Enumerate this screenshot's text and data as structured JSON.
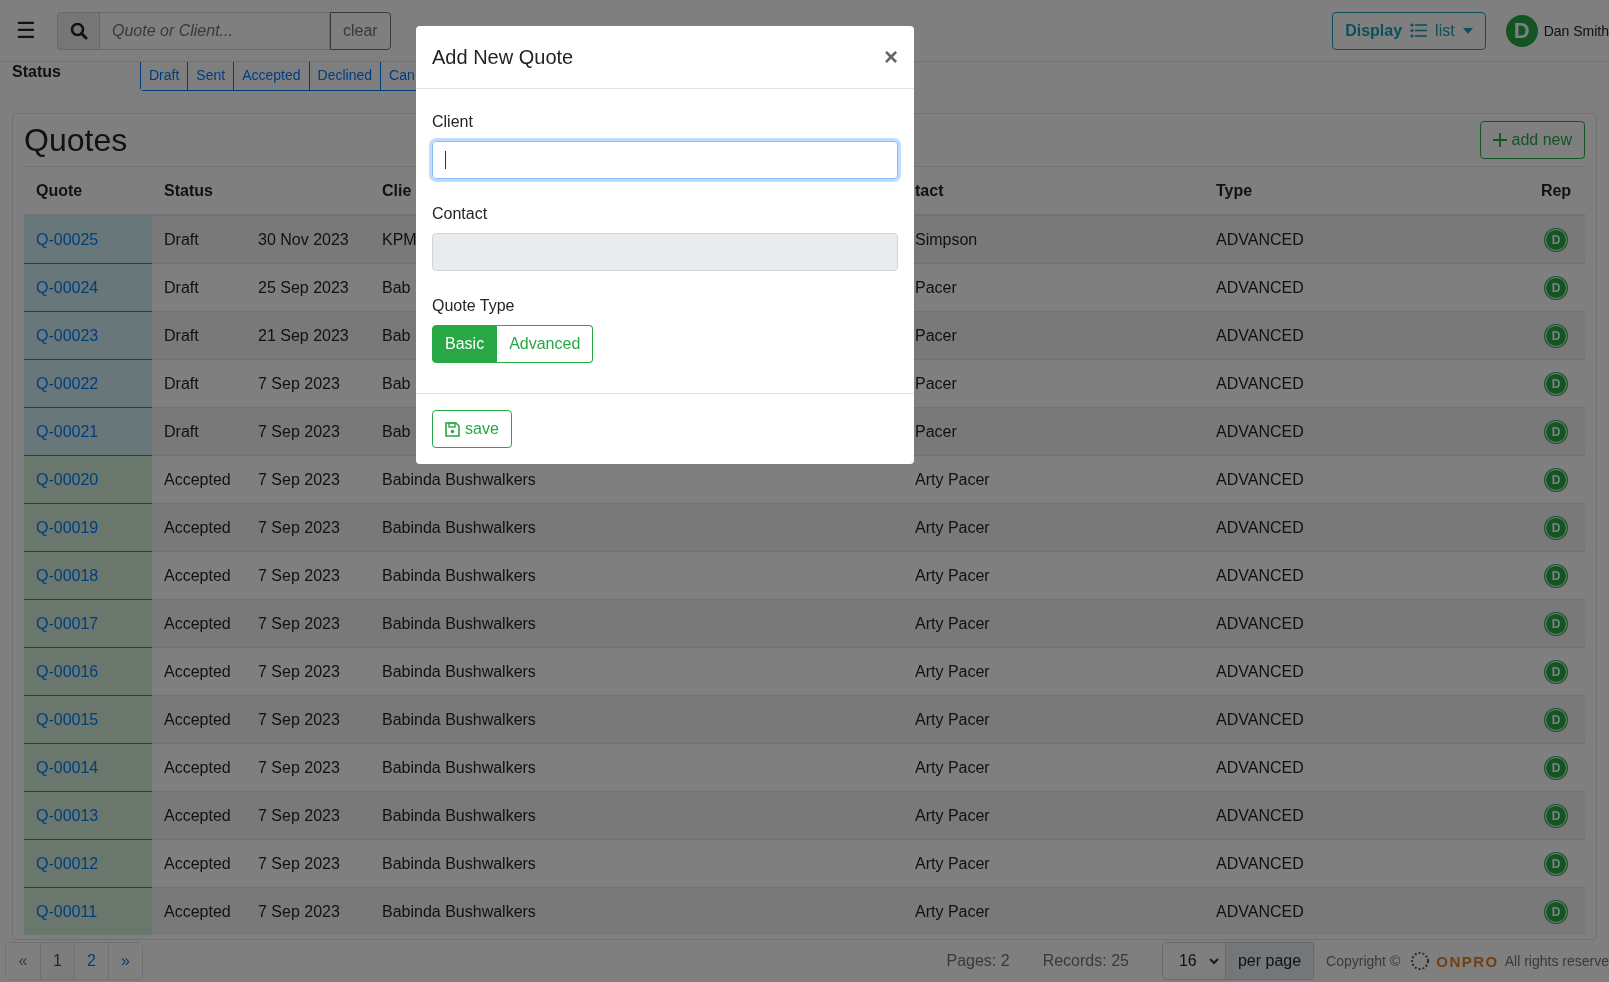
{
  "header": {
    "menu_glyph": "☰",
    "search": {
      "placeholder": "Quote or Client..."
    },
    "clear": "clear",
    "display": {
      "label": "Display",
      "value": "list"
    },
    "user": {
      "initial": "D",
      "name": "Dan Smith"
    }
  },
  "status_filter": {
    "label": "Status",
    "tabs": [
      {
        "label": "Draft",
        "selected": false
      },
      {
        "label": "Sent",
        "selected": false
      },
      {
        "label": "Accepted",
        "selected": false
      },
      {
        "label": "Declined",
        "selected": false
      },
      {
        "label": "Can",
        "selected": false
      }
    ]
  },
  "card": {
    "title": "Quotes",
    "add_button": "add new"
  },
  "table": {
    "columns": [
      "Quote",
      "Status",
      "",
      "Clie",
      "tact",
      "Type",
      "Rep"
    ],
    "rows": [
      {
        "quote": "Q-00025",
        "color": "#687779",
        "status": "Draft",
        "date": "30 Nov 2023",
        "client": "KPM",
        "contact": "Simpson",
        "type": "ADVANCED",
        "rep": "D"
      },
      {
        "quote": "Q-00024",
        "color": "#687779",
        "status": "Draft",
        "date": "25 Sep 2023",
        "client": "Bab",
        "contact": "Pacer",
        "type": "ADVANCED",
        "rep": "D"
      },
      {
        "quote": "Q-00023",
        "color": "#687779",
        "status": "Draft",
        "date": "21 Sep 2023",
        "client": "Bab",
        "contact": "Pacer",
        "type": "ADVANCED",
        "rep": "D"
      },
      {
        "quote": "Q-00022",
        "color": "#687779",
        "status": "Draft",
        "date": "7 Sep 2023",
        "client": "Bab",
        "contact": "Pacer",
        "type": "ADVANCED",
        "rep": "D"
      },
      {
        "quote": "Q-00021",
        "color": "#687779",
        "status": "Draft",
        "date": "7 Sep 2023",
        "client": "Bab",
        "contact": "Pacer",
        "type": "ADVANCED",
        "rep": "D"
      },
      {
        "quote": "Q-00020",
        "color": "#6a776d",
        "status": "Accepted",
        "date": "7 Sep 2023",
        "client": "Babinda Bushwalkers",
        "contact": "Arty Pacer",
        "type": "ADVANCED",
        "rep": "D"
      },
      {
        "quote": "Q-00019",
        "color": "#6a776d",
        "status": "Accepted",
        "date": "7 Sep 2023",
        "client": "Babinda Bushwalkers",
        "contact": "Arty Pacer",
        "type": "ADVANCED",
        "rep": "D"
      },
      {
        "quote": "Q-00018",
        "color": "#6a776d",
        "status": "Accepted",
        "date": "7 Sep 2023",
        "client": "Babinda Bushwalkers",
        "contact": "Arty Pacer",
        "type": "ADVANCED",
        "rep": "D"
      },
      {
        "quote": "Q-00017",
        "color": "#6a776d",
        "status": "Accepted",
        "date": "7 Sep 2023",
        "client": "Babinda Bushwalkers",
        "contact": "Arty Pacer",
        "type": "ADVANCED",
        "rep": "D"
      },
      {
        "quote": "Q-00016",
        "color": "#6a776d",
        "status": "Accepted",
        "date": "7 Sep 2023",
        "client": "Babinda Bushwalkers",
        "contact": "Arty Pacer",
        "type": "ADVANCED",
        "rep": "D"
      },
      {
        "quote": "Q-00015",
        "color": "#6a776d",
        "status": "Accepted",
        "date": "7 Sep 2023",
        "client": "Babinda Bushwalkers",
        "contact": "Arty Pacer",
        "type": "ADVANCED",
        "rep": "D"
      },
      {
        "quote": "Q-00014",
        "color": "#6a776d",
        "status": "Accepted",
        "date": "7 Sep 2023",
        "client": "Babinda Bushwalkers",
        "contact": "Arty Pacer",
        "type": "ADVANCED",
        "rep": "D"
      },
      {
        "quote": "Q-00013",
        "color": "#6a776d",
        "status": "Accepted",
        "date": "7 Sep 2023",
        "client": "Babinda Bushwalkers",
        "contact": "Arty Pacer",
        "type": "ADVANCED",
        "rep": "D"
      },
      {
        "quote": "Q-00012",
        "color": "#6a776d",
        "status": "Accepted",
        "date": "7 Sep 2023",
        "client": "Babinda Bushwalkers",
        "contact": "Arty Pacer",
        "type": "ADVANCED",
        "rep": "D"
      },
      {
        "quote": "Q-00011",
        "color": "#6a776d",
        "status": "Accepted",
        "date": "7 Sep 2023",
        "client": "Babinda Bushwalkers",
        "contact": "Arty Pacer",
        "type": "ADVANCED",
        "rep": "D"
      }
    ]
  },
  "footer": {
    "pagination": [
      {
        "label": "«",
        "selected": false,
        "disabled": true
      },
      {
        "label": "1",
        "selected": true,
        "disabled": false
      },
      {
        "label": "2",
        "selected": false,
        "disabled": false
      },
      {
        "label": "»",
        "selected": false,
        "disabled": false
      }
    ],
    "pages": "Pages: 2",
    "records": "Records: 25",
    "per_page_value": "16",
    "per_page_label": "per page",
    "copyright": "Copyright ©",
    "brand": "ONPRO",
    "rights": "All rights reserve"
  },
  "modal": {
    "title": "Add New Quote",
    "close": "×",
    "fields": [
      {
        "label": "Client",
        "disabled": false,
        "focused": true
      },
      {
        "label": "Contact",
        "disabled": true,
        "focused": false
      }
    ],
    "quote_type": {
      "label": "Quote Type",
      "options": [
        {
          "label": "Basic",
          "selected": true
        },
        {
          "label": "Advanced",
          "selected": false
        }
      ]
    },
    "save": "save"
  }
}
